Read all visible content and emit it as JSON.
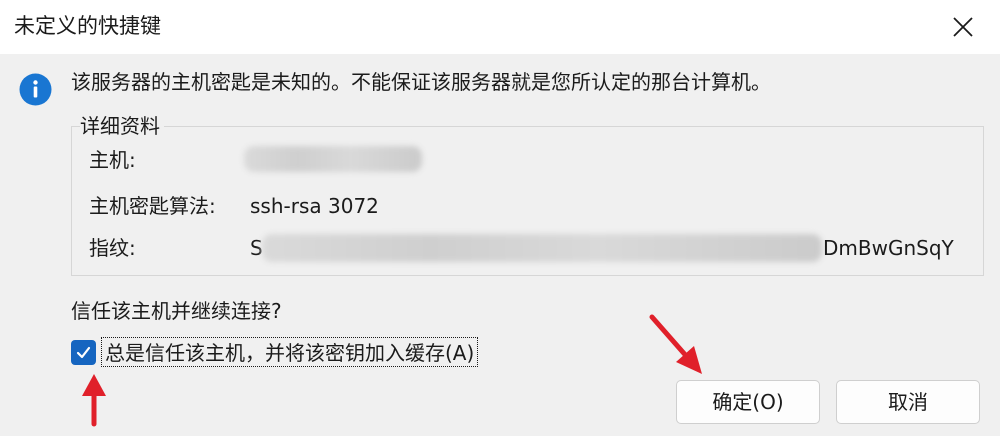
{
  "window": {
    "title": "未定义的快捷键"
  },
  "message": "该服务器的主机密匙是未知的。不能保证该服务器就是您所认定的那台计算机。",
  "details": {
    "legend": "详细资料",
    "host_label": "主机:",
    "key_algo_label": "主机密匙算法:",
    "key_algo_value": "ssh-rsa 3072",
    "fingerprint_label": "指纹:",
    "fingerprint_prefix": "S",
    "fingerprint_suffix": "DmBwGnSqY"
  },
  "question": "信任该主机并继续连接?",
  "checkbox": {
    "label": "总是信任该主机，并将该密钥加入缓存(A)",
    "checked": true
  },
  "buttons": {
    "ok": "确定(O)",
    "cancel": "取消"
  },
  "colors": {
    "accent": "#1565c0",
    "annotation_arrow": "#e0202a",
    "info_icon": "#1976d2"
  },
  "icons": {
    "close": "close-icon",
    "info": "info-icon",
    "check": "checkmark-icon"
  }
}
